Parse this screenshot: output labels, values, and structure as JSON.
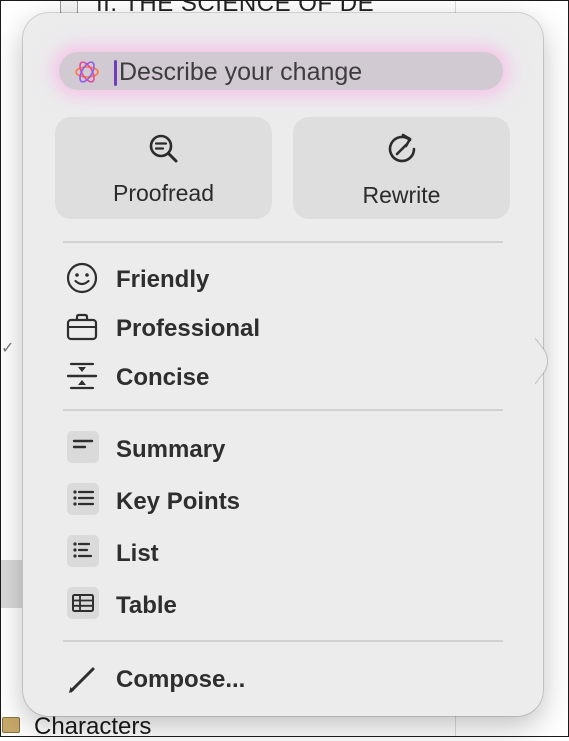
{
  "background": {
    "doc_title": "II. THE SCIENCE OF DE",
    "sidebar_item": "Characters"
  },
  "popover": {
    "search": {
      "placeholder": "Describe your change"
    },
    "actions": [
      {
        "id": "proofread",
        "label": "Proofread",
        "icon": "magnifier-check-icon"
      },
      {
        "id": "rewrite",
        "label": "Rewrite",
        "icon": "rewrite-circle-arrow-icon"
      }
    ],
    "tones": [
      {
        "id": "friendly",
        "label": "Friendly",
        "icon": "smiley-icon"
      },
      {
        "id": "professional",
        "label": "Professional",
        "icon": "briefcase-icon"
      },
      {
        "id": "concise",
        "label": "Concise",
        "icon": "compress-icon"
      }
    ],
    "formats": [
      {
        "id": "summary",
        "label": "Summary",
        "icon": "summary-lines-icon"
      },
      {
        "id": "key_points",
        "label": "Key Points",
        "icon": "bullet-list-icon"
      },
      {
        "id": "list",
        "label": "List",
        "icon": "list-icon"
      },
      {
        "id": "table",
        "label": "Table",
        "icon": "table-icon"
      }
    ],
    "compose": {
      "label": "Compose...",
      "icon": "pencil-icon"
    }
  },
  "colors": {
    "panel": "#ececec",
    "button": "#dedede",
    "text": "#2e2e2e",
    "caret": "#6d40b8",
    "glow": "#ffaadc"
  }
}
